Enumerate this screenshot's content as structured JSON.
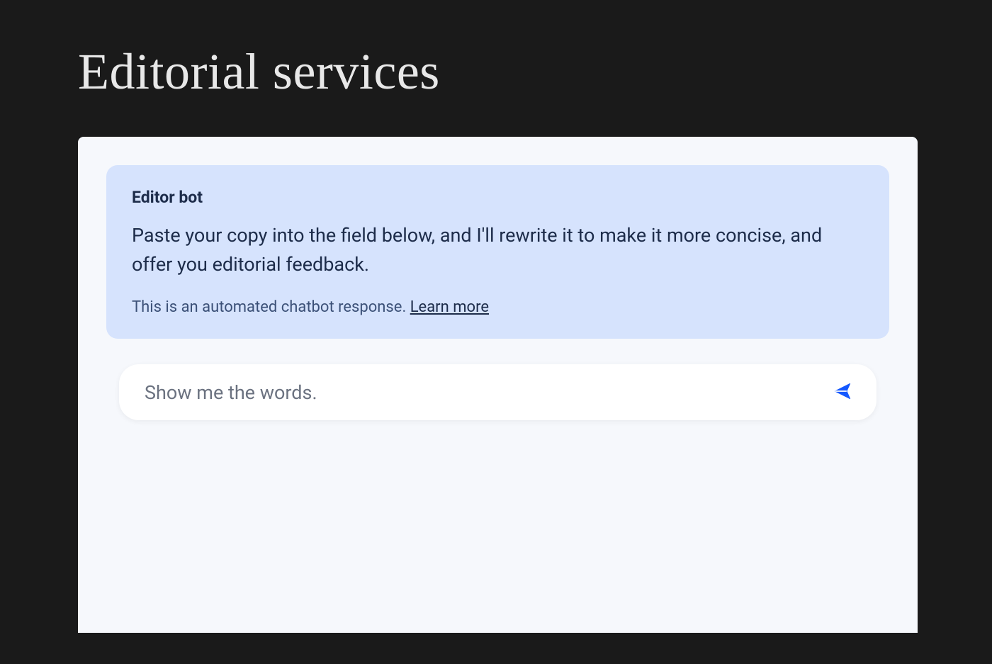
{
  "header": {
    "title": "Editorial services"
  },
  "bot_message": {
    "name": "Editor bot",
    "text": "Paste your copy into the field below, and I'll rewrite it to make it more concise, and offer you editorial feedback.",
    "disclaimer": "This is an automated chatbot response. ",
    "learn_more": "Learn more"
  },
  "input": {
    "placeholder": "Show me the words."
  }
}
